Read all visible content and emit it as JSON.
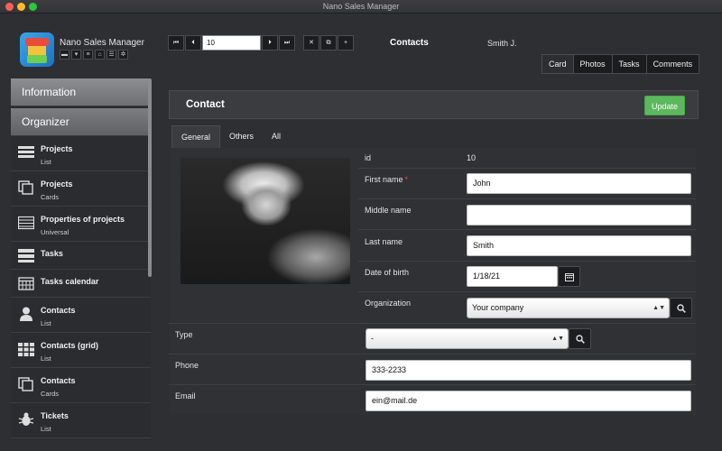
{
  "window": {
    "title": "Nano Sales Manager"
  },
  "app": {
    "name": "Nano Sales Manager",
    "tool_icons": [
      "truck-icon",
      "cart-icon",
      "doc-icon",
      "home-icon",
      "list-icon",
      "gears-icon"
    ]
  },
  "sidebar": {
    "sections": [
      "Information",
      "Organizer"
    ],
    "items": [
      {
        "label": "Projects",
        "sub": "List",
        "icon": "list-icon"
      },
      {
        "label": "Projects",
        "sub": "Cards",
        "icon": "cards-icon"
      },
      {
        "label": "Properties of projects",
        "sub": "Universal",
        "icon": "table-icon"
      },
      {
        "label": "Tasks",
        "sub": "",
        "icon": "tasks-icon"
      },
      {
        "label": "Tasks calendar",
        "sub": "",
        "icon": "calendar-icon"
      },
      {
        "label": "Contacts",
        "sub": "List",
        "icon": "person-icon"
      },
      {
        "label": "Contacts (grid)",
        "sub": "List",
        "icon": "grid-icon"
      },
      {
        "label": "Contacts",
        "sub": "Cards",
        "icon": "cards-icon"
      },
      {
        "label": "Tickets",
        "sub": "List",
        "icon": "bug-icon"
      }
    ]
  },
  "toolbar": {
    "record_value": "10",
    "nav_buttons": [
      "first",
      "prev",
      "next",
      "last"
    ],
    "action_buttons": [
      "delete",
      "copy",
      "add"
    ]
  },
  "header": {
    "title": "Contacts",
    "user": "Smith J."
  },
  "view_tabs": [
    {
      "label": "Card",
      "active": true
    },
    {
      "label": "Photos",
      "active": false
    },
    {
      "label": "Tasks",
      "active": false
    },
    {
      "label": "Comments",
      "active": false
    }
  ],
  "panel": {
    "title": "Contact",
    "update_label": "Update"
  },
  "sub_tabs": [
    {
      "label": "General",
      "active": true
    },
    {
      "label": "Others",
      "active": false
    },
    {
      "label": "All",
      "active": false
    }
  ],
  "form": {
    "id_label": "id",
    "id_value": "10",
    "first_name_label": "First name",
    "required_mark": "*",
    "first_name": "John",
    "middle_name_label": "Middle name",
    "middle_name": "",
    "last_name_label": "Last name",
    "last_name": "Smith",
    "dob_label": "Date of birth",
    "dob": "1/18/21",
    "org_label": "Organization",
    "org": "Your company",
    "type_label": "Type",
    "type": "-",
    "phone_label": "Phone",
    "phone": "333-2233",
    "email_label": "Email",
    "email": "ein@mail.de"
  },
  "colors": {
    "accent_green": "#5cb85c",
    "required": "#d9534f",
    "background": "#2d2f33"
  }
}
